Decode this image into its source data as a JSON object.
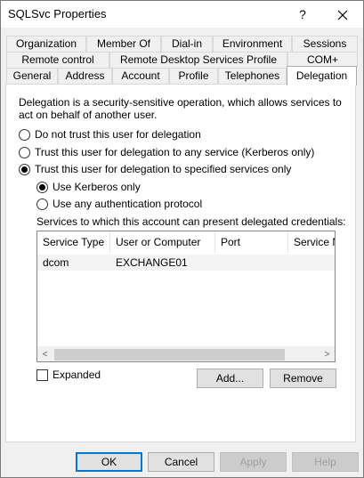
{
  "window": {
    "title": "SQLSvc Properties",
    "help_label": "?"
  },
  "tabs": {
    "row1": [
      "Organization",
      "Member Of",
      "Dial-in",
      "Environment",
      "Sessions"
    ],
    "row2": [
      "Remote control",
      "Remote Desktop Services Profile",
      "COM+"
    ],
    "row3": [
      "General",
      "Address",
      "Account",
      "Profile",
      "Telephones",
      "Delegation"
    ],
    "active": "Delegation"
  },
  "delegation": {
    "description": "Delegation is a security-sensitive operation, which allows services to act on behalf of another user.",
    "options": {
      "no_trust": "Do not trust this user for delegation",
      "any_service": "Trust this user for delegation to any service (Kerberos only)",
      "specified": "Trust this user for delegation to specified services only"
    },
    "selected_option": "specified",
    "protocol": {
      "kerberos_only": "Use Kerberos only",
      "any_protocol": "Use any authentication protocol",
      "selected": "kerberos_only"
    },
    "services_label": "Services to which this account can present delegated credentials:",
    "columns": [
      "Service Type",
      "User or Computer",
      "Port",
      "Service Name"
    ],
    "rows": [
      {
        "service_type": "dcom",
        "user_or_computer": "EXCHANGE01",
        "port": "",
        "service_name": ""
      }
    ],
    "expanded_label": "Expanded",
    "add_label": "Add...",
    "remove_label": "Remove"
  },
  "footer": {
    "ok_label": "OK",
    "cancel_label": "Cancel",
    "apply_label": "Apply",
    "help_label": "Help"
  },
  "scroll": {
    "left_arrow": "<",
    "right_arrow": ">"
  }
}
